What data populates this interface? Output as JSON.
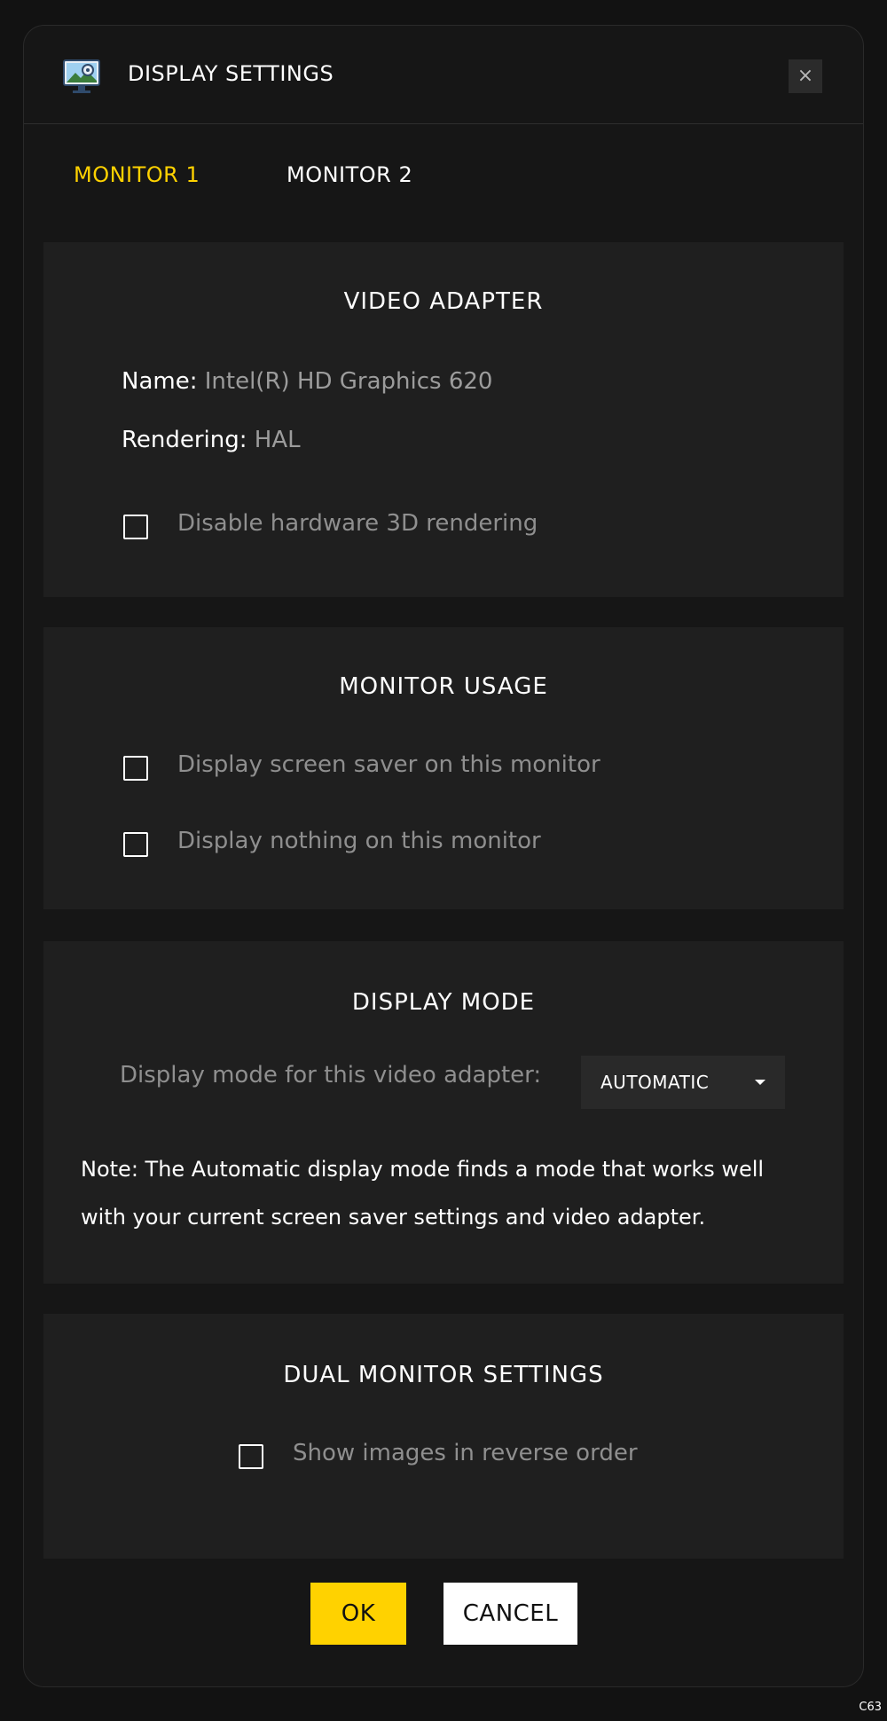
{
  "dialog": {
    "title": "DISPLAY SETTINGS",
    "icon": "monitor-settings-icon",
    "close_label": "×"
  },
  "tabs": [
    {
      "label": "MONITOR 1",
      "active": true
    },
    {
      "label": "MONITOR 2",
      "active": false
    }
  ],
  "video_adapter": {
    "title": "VIDEO ADAPTER",
    "name_label": "Name:",
    "name_value": "Intel(R) HD Graphics 620",
    "rendering_label": "Rendering:",
    "rendering_value": "HAL",
    "disable_3d": {
      "label": "Disable hardware 3D rendering",
      "checked": false
    }
  },
  "monitor_usage": {
    "title": "MONITOR USAGE",
    "options": [
      {
        "label": "Display screen saver on this monitor",
        "checked": false
      },
      {
        "label": "Display nothing on this monitor",
        "checked": false
      }
    ]
  },
  "display_mode": {
    "title": "DISPLAY MODE",
    "label": "Display mode for this video adapter:",
    "selected": "AUTOMATIC",
    "note": "Note: The Automatic display mode finds a mode that works well with your current screen saver settings and video adapter."
  },
  "dual_monitor": {
    "title": "DUAL MONITOR SETTINGS",
    "reverse_order": {
      "label": "Show images in reverse order",
      "checked": false
    }
  },
  "buttons": {
    "ok": "OK",
    "cancel": "CANCEL"
  },
  "corner_code": "C63",
  "colors": {
    "accent": "#ffd200",
    "background": "#121212",
    "panel": "#1f1f1f",
    "muted_text": "#8f8f8f"
  }
}
